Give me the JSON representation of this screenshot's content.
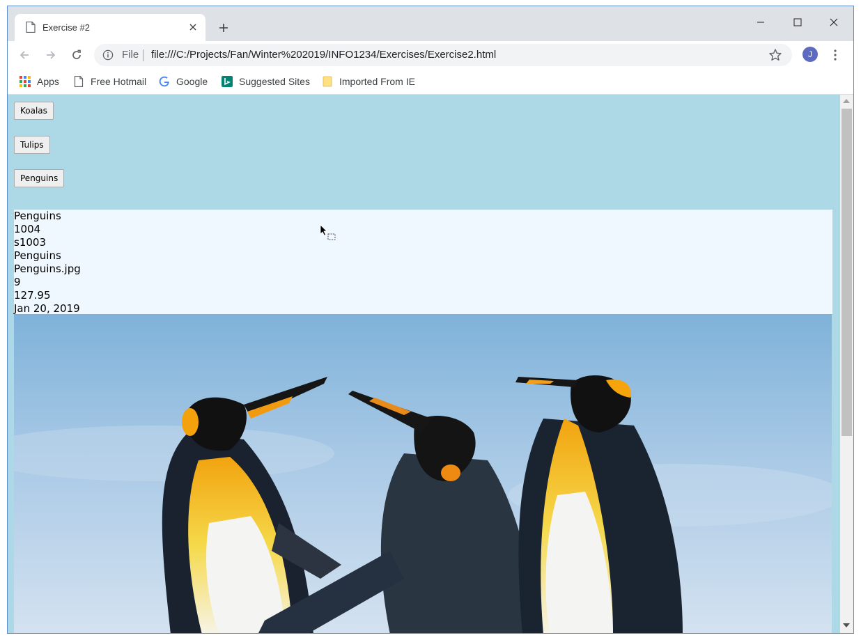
{
  "tab": {
    "title": "Exercise #2",
    "close_icon": "close-icon",
    "new_tab_icon": "plus-icon"
  },
  "window_controls": {
    "minimize": "minimize-icon",
    "maximize": "maximize-icon",
    "close": "close-icon"
  },
  "toolbar": {
    "scheme_label": "File",
    "url": "file:///C:/Projects/Fan/Winter%202019/INFO1234/Exercises/Exercise2.html",
    "avatar_letter": "J"
  },
  "bookmarks": [
    {
      "label": "Apps",
      "icon": "apps-grid-icon"
    },
    {
      "label": "Free Hotmail",
      "icon": "page-icon"
    },
    {
      "label": "Google",
      "icon": "google-icon"
    },
    {
      "label": "Suggested Sites",
      "icon": "bing-icon"
    },
    {
      "label": "Imported From IE",
      "icon": "folder-icon"
    }
  ],
  "page": {
    "buttons": [
      "Koalas",
      "Tulips",
      "Penguins"
    ],
    "details": [
      "Penguins",
      "1004",
      "s1003",
      "Penguins",
      "Penguins.jpg",
      "9",
      "127.95",
      "Jan 20, 2019"
    ],
    "colors": {
      "page_background": "#add8e6",
      "details_background": "#f0f8ff"
    }
  }
}
